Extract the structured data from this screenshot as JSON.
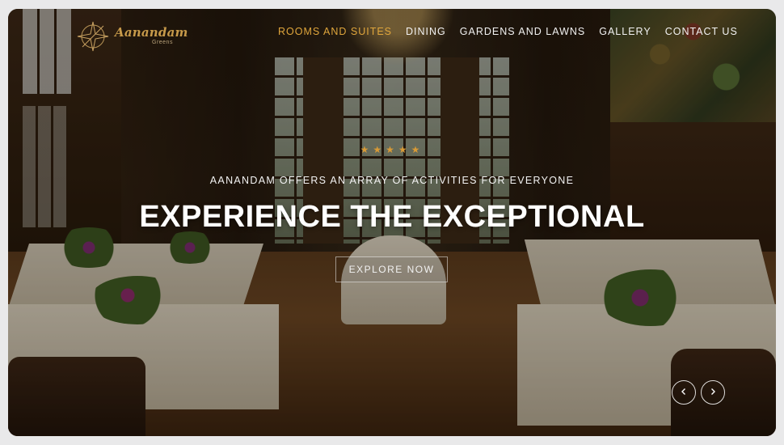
{
  "brand": {
    "name": "Aanandam",
    "sub": "Greens",
    "logo_icon": "compass-star-icon",
    "accent_color": "#c79a4a"
  },
  "nav": {
    "items": [
      {
        "label": "ROOMS AND SUITES",
        "active": true
      },
      {
        "label": "DINING",
        "active": false
      },
      {
        "label": "GARDENS AND LAWNS",
        "active": false
      },
      {
        "label": "GALLERY",
        "active": false
      },
      {
        "label": "CONTACT US",
        "active": false
      }
    ],
    "active_color": "#e0a63c"
  },
  "hero": {
    "stars": "★★★★★",
    "star_rating": 5,
    "tagline": "AANANDAM OFFERS AN ARRAY OF ACTIVITIES FOR EVERYONE",
    "headline": "EXPERIENCE THE EXCEPTIONAL",
    "cta_label": "EXPLORE NOW"
  },
  "carousel": {
    "prev_icon": "chevron-left-icon",
    "next_icon": "chevron-right-icon"
  }
}
